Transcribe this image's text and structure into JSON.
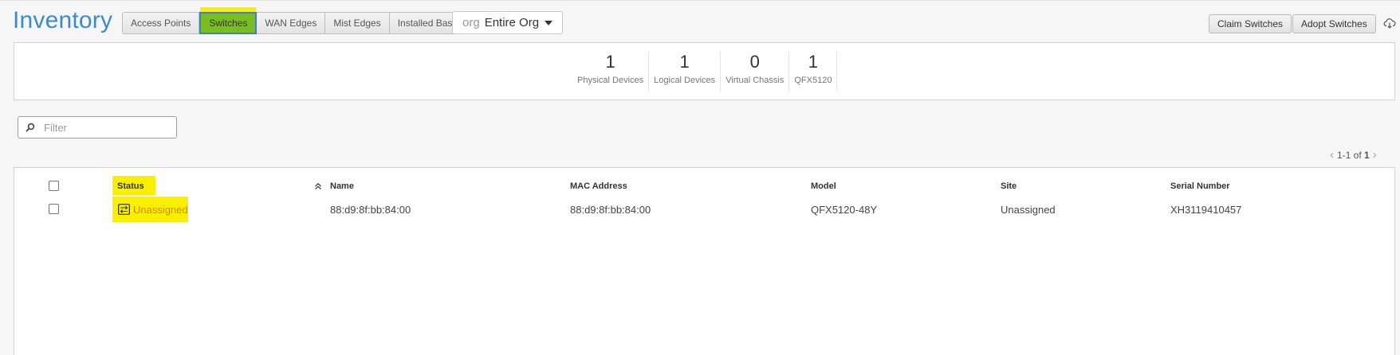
{
  "page": {
    "title": "Inventory"
  },
  "tabs": [
    {
      "label": "Access Points",
      "active": false
    },
    {
      "label": "Switches",
      "active": true
    },
    {
      "label": "WAN Edges",
      "active": false
    },
    {
      "label": "Mist Edges",
      "active": false
    },
    {
      "label": "Installed Base",
      "active": false
    }
  ],
  "org_select": {
    "prefix": "org",
    "value": "Entire Org"
  },
  "actions": {
    "claim_label": "Claim Switches",
    "adopt_label": "Adopt Switches"
  },
  "summary": [
    {
      "value": "1",
      "label": "Physical Devices"
    },
    {
      "value": "1",
      "label": "Logical Devices"
    },
    {
      "value": "0",
      "label": "Virtual Chassis"
    },
    {
      "value": "1",
      "label": "QFX5120"
    }
  ],
  "filter": {
    "placeholder": "Filter",
    "value": ""
  },
  "pagination": {
    "range": "1-1 of",
    "total": "1"
  },
  "table": {
    "columns": [
      "Status",
      "Name",
      "MAC Address",
      "Model",
      "Site",
      "Serial Number"
    ],
    "rows": [
      {
        "status": "Unassigned",
        "name": "88:d9:8f:bb:84:00",
        "mac": "88:d9:8f:bb:84:00",
        "model": "QFX5120-48Y",
        "site": "Unassigned",
        "serial": "XH3119410457"
      }
    ]
  },
  "colors": {
    "accent": "#3b8bd0",
    "active_tab": "#78be20",
    "highlight": "#f8f000",
    "status_unassigned": "#d08b00"
  }
}
